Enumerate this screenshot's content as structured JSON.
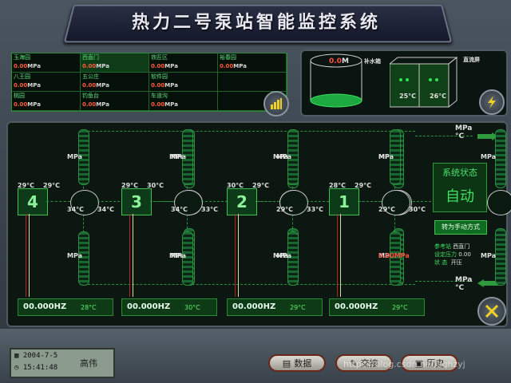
{
  "title": "热力二号泵站智能监控系统",
  "stations": [
    {
      "name": "玉海园",
      "value": "0.00",
      "unit": "MPa"
    },
    {
      "name": "西直门",
      "value": "0.00",
      "unit": "MPa"
    },
    {
      "name": "铁匠区",
      "value": "0.00",
      "unit": "MPa"
    },
    {
      "name": "裕春园",
      "value": "0.00",
      "unit": "MPa"
    },
    {
      "name": "八王园",
      "value": "0.00",
      "unit": "MPa"
    },
    {
      "name": "五公庄",
      "value": "0.00",
      "unit": "MPa"
    },
    {
      "name": "软件园",
      "value": "0.00",
      "unit": "MPa"
    },
    {
      "name": "",
      "value": "",
      "unit": ""
    },
    {
      "name": "桃园",
      "value": "0.00",
      "unit": "MPa"
    },
    {
      "name": "钓鱼台",
      "value": "0.00",
      "unit": "MPa"
    },
    {
      "name": "车道沟",
      "value": "0.00",
      "unit": "MPa"
    },
    {
      "name": "",
      "value": "",
      "unit": ""
    }
  ],
  "tank": {
    "value": "0.0",
    "unit": "M",
    "label": "补水箱"
  },
  "cabinet": {
    "label": "直流屏",
    "t1": "25°C",
    "t2": "26°C"
  },
  "outlet": {
    "p": "MPa",
    "t": "°C"
  },
  "inlet": {
    "p": "MPa",
    "t": "°C"
  },
  "pumps": [
    {
      "num": "4",
      "tin": "29°C",
      "tout": "29°C",
      "t1": "34°C",
      "t2": "34°C",
      "p_top": "MPa",
      "p_bot": "MPa",
      "hz": "00.000HZ",
      "motor_t": "28°C"
    },
    {
      "num": "3",
      "tin": "29°C",
      "tout": "30°C",
      "t1": "34°C",
      "t2": "33°C",
      "p_top": "MPa",
      "p_bot": "MPa",
      "hz": "00.000HZ",
      "motor_t": "30°C"
    },
    {
      "num": "2",
      "tin": "30°C",
      "tout": "29°C",
      "t1": "29°C",
      "t2": "33°C",
      "p_top": "MPa",
      "p_bot": "MPa",
      "hz": "00.000HZ",
      "motor_t": "29°C"
    },
    {
      "num": "1",
      "tin": "28°C",
      "tout": "29°C",
      "t1": "29°C",
      "t2": "30°C",
      "p_top": "MPa",
      "p_bot": "0.00MPa",
      "hz": "00.000HZ",
      "motor_t": "29°C"
    }
  ],
  "status": {
    "heading": "系统状态",
    "mode": "自动",
    "switch_btn": "转为手动方式",
    "ref_station_label": "参考站",
    "ref_station": "西直门",
    "pressure_label": "设定压力",
    "pressure": "0.00",
    "state_label": "状 态",
    "state": "开压"
  },
  "footer": {
    "date": "2004-7-5",
    "time": "15:41:48",
    "user": "高伟",
    "btn_data": "数据",
    "btn_shift": "交接",
    "btn_history": "历史",
    "watermark": "https://blog.csdn.net/zqhzyj"
  }
}
